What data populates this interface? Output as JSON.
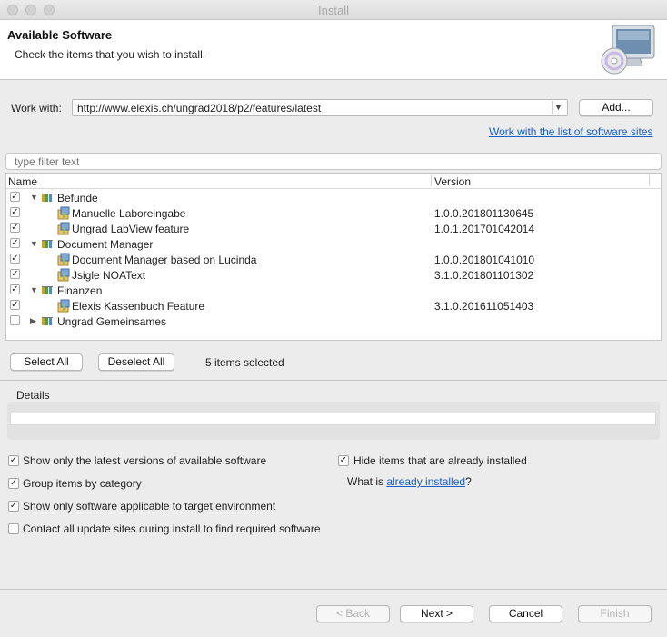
{
  "window": {
    "title": "Install"
  },
  "header": {
    "title": "Available Software",
    "subtitle": "Check the items that you wish to install."
  },
  "work_with": {
    "label": "Work with:",
    "value": "http://www.elexis.ch/ungrad2018/p2/features/latest",
    "add_button": "Add...",
    "sites_link": "Work with the list of software sites"
  },
  "filter": {
    "placeholder": "type filter text"
  },
  "table": {
    "columns": [
      "Name",
      "Version"
    ],
    "rows": [
      {
        "name": "Befunde",
        "version": "",
        "type": "category",
        "checked": true,
        "expanded": true
      },
      {
        "name": "Manuelle Laboreingabe",
        "version": "1.0.0.201801130645",
        "type": "feature",
        "checked": true
      },
      {
        "name": "Ungrad LabView feature",
        "version": "1.0.1.201701042014",
        "type": "feature",
        "checked": true
      },
      {
        "name": "Document Manager",
        "version": "",
        "type": "category",
        "checked": true,
        "expanded": true
      },
      {
        "name": "Document Manager based on Lucinda",
        "version": "1.0.0.201801041010",
        "type": "feature",
        "checked": true
      },
      {
        "name": "Jsigle NOAText",
        "version": "3.1.0.201801101302",
        "type": "feature",
        "checked": true
      },
      {
        "name": "Finanzen",
        "version": "",
        "type": "category",
        "checked": true,
        "expanded": true
      },
      {
        "name": "Elexis Kassenbuch Feature",
        "version": "3.1.0.201611051403",
        "type": "feature",
        "checked": true
      },
      {
        "name": "Ungrad Gemeinsames",
        "version": "",
        "type": "category",
        "checked": false,
        "expanded": false
      }
    ]
  },
  "selection": {
    "select_all": "Select All",
    "deselect_all": "Deselect All",
    "status": "5 items selected"
  },
  "details": {
    "label": "Details"
  },
  "options": {
    "latest_versions": {
      "label": "Show only the latest versions of available software",
      "checked": true
    },
    "group_by_category": {
      "label": "Group items by category",
      "checked": true
    },
    "applicable_only": {
      "label": "Show only software applicable to target environment",
      "checked": true
    },
    "contact_all_sites": {
      "label": "Contact all update sites during install to find required software",
      "checked": false
    },
    "hide_installed": {
      "label": "Hide items that are already installed",
      "checked": true
    },
    "what_is": {
      "prefix": "What is ",
      "link": "already installed",
      "suffix": "?"
    }
  },
  "footer": {
    "back": "< Back",
    "next": "Next >",
    "cancel": "Cancel",
    "finish": "Finish"
  },
  "icons": {
    "header": "monitor-cd-icon",
    "category": "category-bars-icon",
    "feature": "feature-plugin-icon"
  }
}
